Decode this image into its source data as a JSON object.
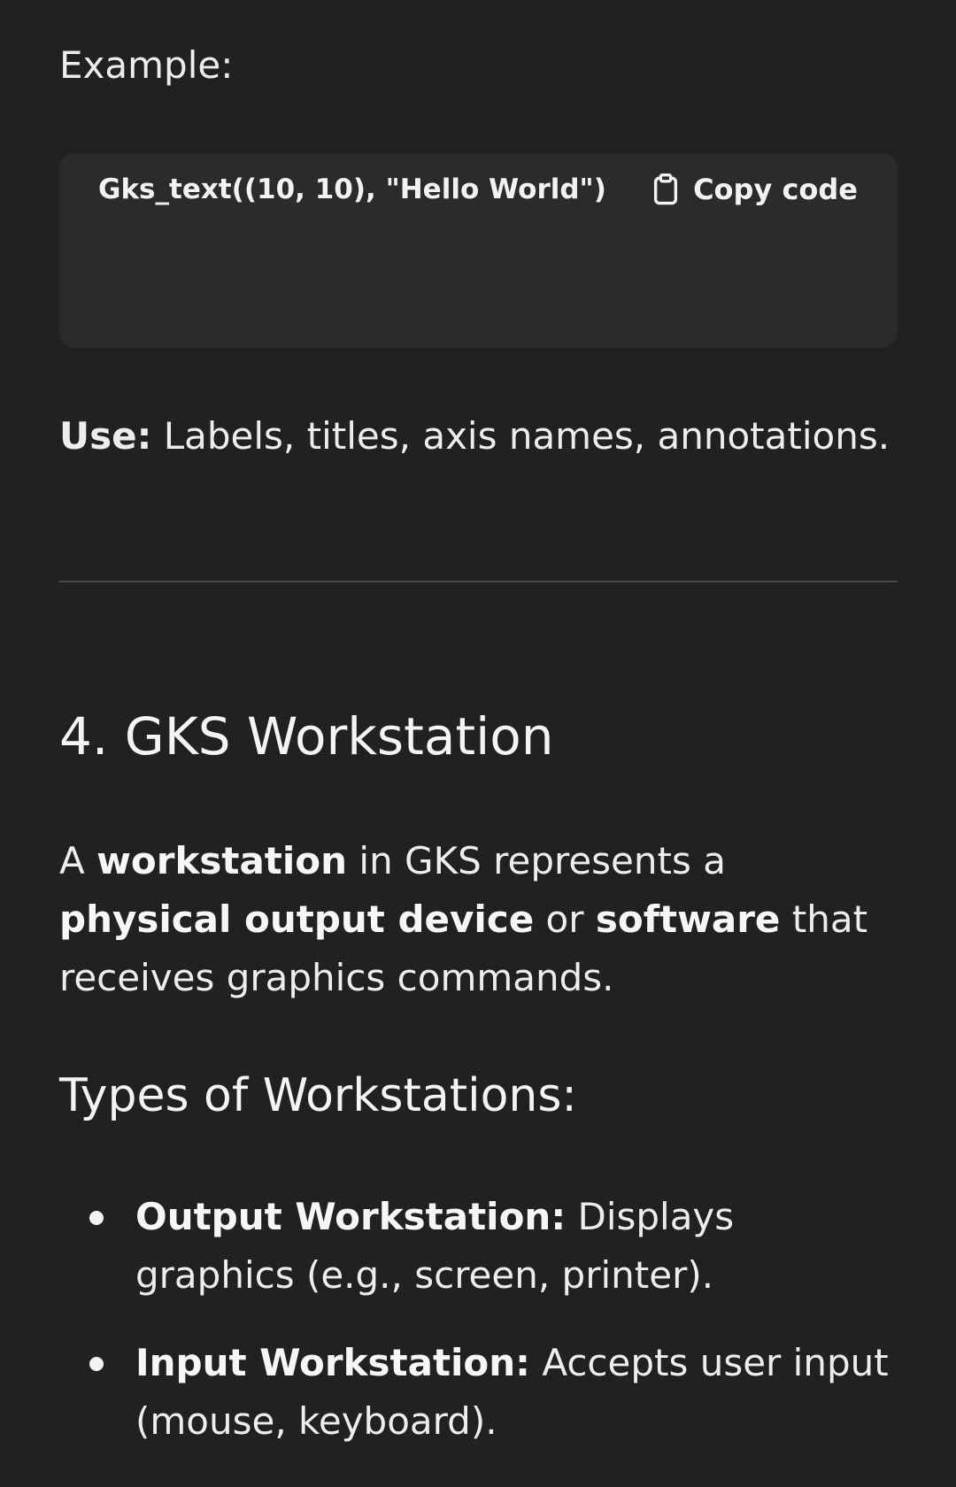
{
  "example": {
    "label": "Example:"
  },
  "code_block": {
    "code": "Gks_text((10, 10), \"Hello World\")",
    "copy_label": "Copy code",
    "copy_icon": "clipboard-icon"
  },
  "use": {
    "label": "Use:",
    "text": " Labels, titles, axis names, annotations."
  },
  "section": {
    "heading": "4. GKS Workstation",
    "para_parts": [
      "A ",
      "workstation",
      " in GKS represents a ",
      "physical output device",
      " or ",
      "software",
      " that receives graphics commands."
    ],
    "subheading": "Types of Workstations:",
    "items": [
      {
        "term": "Output Workstation:",
        "desc": " Displays graphics (e.g., screen, printer)."
      },
      {
        "term": "Input Workstation:",
        "desc": " Accepts user input (mouse, keyboard)."
      }
    ]
  },
  "colors": {
    "background": "#212121",
    "code_background": "#2b2b2b",
    "text": "#ededed",
    "divider": "#4a4a4a"
  }
}
